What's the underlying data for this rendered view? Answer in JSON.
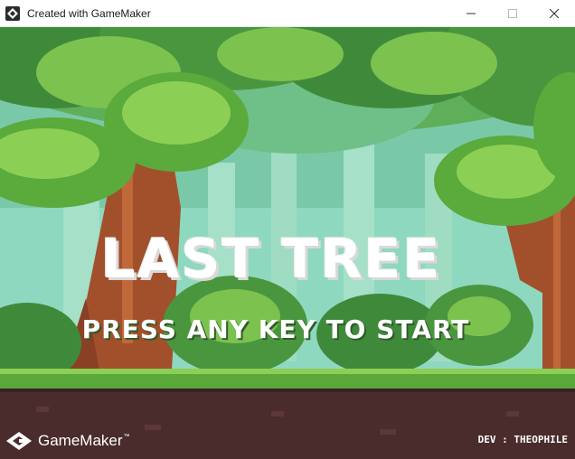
{
  "window": {
    "title": "Created with GameMaker",
    "icon": "gamemaker-icon",
    "controls": [
      "minimize-icon",
      "maximize-icon",
      "close-icon"
    ]
  },
  "game": {
    "title": "LAST TREE",
    "prompt": "PRESS ANY KEY TO START",
    "engine_logo": "GameMaker",
    "engine_logo_tm": "™",
    "credit": "DEV : THEOPHILE",
    "scene": "pixel-art forest with trees, bushes and dirt ground"
  },
  "colors": {
    "sky_mist": "#8fd8c0",
    "foliage_dark": "#3f8a3a",
    "foliage_light": "#7cc24e",
    "trunk": "#a2502c",
    "grass": "#5aa83a",
    "dirt": "#4a2c2c",
    "text": "#ffffff"
  }
}
